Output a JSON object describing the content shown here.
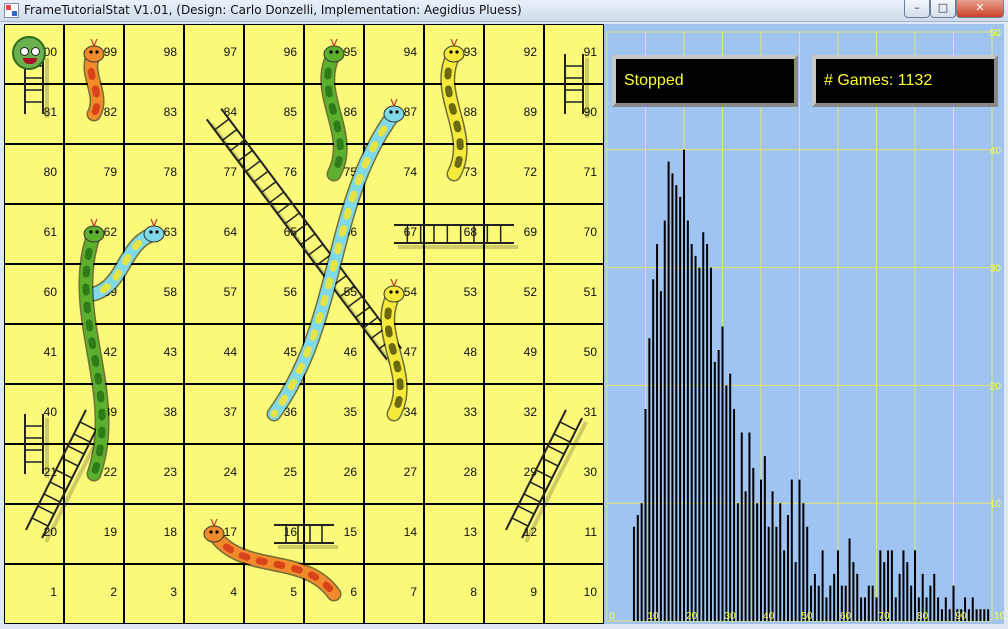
{
  "window": {
    "title": "FrameTutorialStat V1.01, (Design: Carlo Donzelli, Implementation: Aegidius Pluess)",
    "min_glyph": "–",
    "max_glyph": "□",
    "close_glyph": "✕"
  },
  "board": {
    "cell_numbers": [
      [
        100,
        99,
        98,
        97,
        96,
        95,
        94,
        93,
        92,
        91
      ],
      [
        81,
        82,
        83,
        84,
        85,
        86,
        87,
        88,
        89,
        90
      ],
      [
        80,
        79,
        78,
        77,
        76,
        75,
        74,
        73,
        72,
        71
      ],
      [
        61,
        62,
        63,
        64,
        65,
        66,
        67,
        68,
        69,
        70
      ],
      [
        60,
        59,
        58,
        57,
        56,
        55,
        54,
        53,
        52,
        51
      ],
      [
        41,
        42,
        43,
        44,
        45,
        46,
        47,
        48,
        49,
        50
      ],
      [
        40,
        39,
        38,
        37,
        36,
        35,
        34,
        33,
        32,
        31
      ],
      [
        21,
        22,
        23,
        24,
        25,
        26,
        27,
        28,
        29,
        30
      ],
      [
        20,
        19,
        18,
        17,
        16,
        15,
        14,
        13,
        12,
        11
      ],
      [
        1,
        2,
        3,
        4,
        5,
        6,
        7,
        8,
        9,
        10
      ]
    ],
    "snakes": [
      {
        "from": 99,
        "to": 82,
        "color": "#f08a2a",
        "spot": "#d9431b"
      },
      {
        "from": 95,
        "to": 75,
        "color": "#5cb02e",
        "spot": "#2f7a19"
      },
      {
        "from": 93,
        "to": 73,
        "color": "#f5ea3a",
        "spot": "#6b6a12"
      },
      {
        "from": 87,
        "to": 36,
        "color": "#7fd9e6",
        "spot": "#e6e346"
      },
      {
        "from": 63,
        "to": 59,
        "color": "#7fd9e6",
        "spot": "#e6e346"
      },
      {
        "from": 62,
        "to": 22,
        "color": "#5cb02e",
        "spot": "#2f7a19"
      },
      {
        "from": 54,
        "to": 34,
        "color": "#f5ea3a",
        "spot": "#6b6a12"
      },
      {
        "from": 17,
        "to": 6,
        "color": "#f08a2a",
        "spot": "#d9431b"
      }
    ],
    "ladders": [
      {
        "from": 81,
        "to": 100
      },
      {
        "from": 84,
        "to": 47
      },
      {
        "from": 67,
        "to": 69
      },
      {
        "from": 90,
        "to": 91
      },
      {
        "from": 21,
        "to": 40
      },
      {
        "from": 20,
        "to": 39
      },
      {
        "from": 12,
        "to": 31
      },
      {
        "from": 16,
        "to": 15
      }
    ],
    "token_icon": "frog-face-icon",
    "token_cell": 100
  },
  "stats": {
    "status_text": "Stopped",
    "games_text": "# Games: 1132"
  },
  "chart_data": {
    "type": "bar",
    "xlabel": "",
    "ylabel": "",
    "xlim": [
      0,
      100
    ],
    "ylim": [
      0,
      50
    ],
    "x_ticks": [
      0,
      10,
      20,
      30,
      40,
      50,
      60,
      70,
      80,
      90,
      100
    ],
    "y_ticks": [
      10,
      20,
      30,
      40,
      50
    ],
    "grid": true,
    "bar_color": "#000000",
    "axis_color": "#ffff33",
    "x": [
      7,
      8,
      9,
      10,
      11,
      12,
      13,
      14,
      15,
      16,
      17,
      18,
      19,
      20,
      21,
      22,
      23,
      24,
      25,
      26,
      27,
      28,
      29,
      30,
      31,
      32,
      33,
      34,
      35,
      36,
      37,
      38,
      39,
      40,
      41,
      42,
      43,
      44,
      45,
      46,
      47,
      48,
      49,
      50,
      51,
      52,
      53,
      54,
      55,
      56,
      57,
      58,
      59,
      60,
      61,
      62,
      63,
      64,
      65,
      66,
      67,
      68,
      69,
      70,
      71,
      72,
      73,
      74,
      75,
      76,
      77,
      78,
      79,
      80,
      81,
      82,
      83,
      84,
      85,
      86,
      87,
      88,
      89,
      90,
      91,
      92,
      93,
      94,
      95,
      96,
      97,
      98,
      99
    ],
    "values": [
      8,
      9,
      10,
      18,
      24,
      29,
      32,
      28,
      34,
      39,
      38,
      37,
      36,
      40,
      34,
      32,
      31,
      30,
      33,
      32,
      30,
      22,
      23,
      25,
      20,
      21,
      18,
      10,
      16,
      11,
      16,
      13,
      10,
      12,
      14,
      8,
      11,
      8,
      10,
      6,
      9,
      12,
      5,
      12,
      10,
      8,
      3,
      4,
      3,
      6,
      2,
      3,
      4,
      6,
      3,
      3,
      7,
      5,
      4,
      2,
      2,
      3,
      3,
      2,
      6,
      5,
      6,
      6,
      2,
      4,
      6,
      5,
      3,
      6,
      2,
      4,
      2,
      3,
      4,
      2,
      1,
      2,
      1,
      3,
      1,
      1,
      2,
      1,
      2,
      1,
      1,
      1,
      1
    ]
  }
}
